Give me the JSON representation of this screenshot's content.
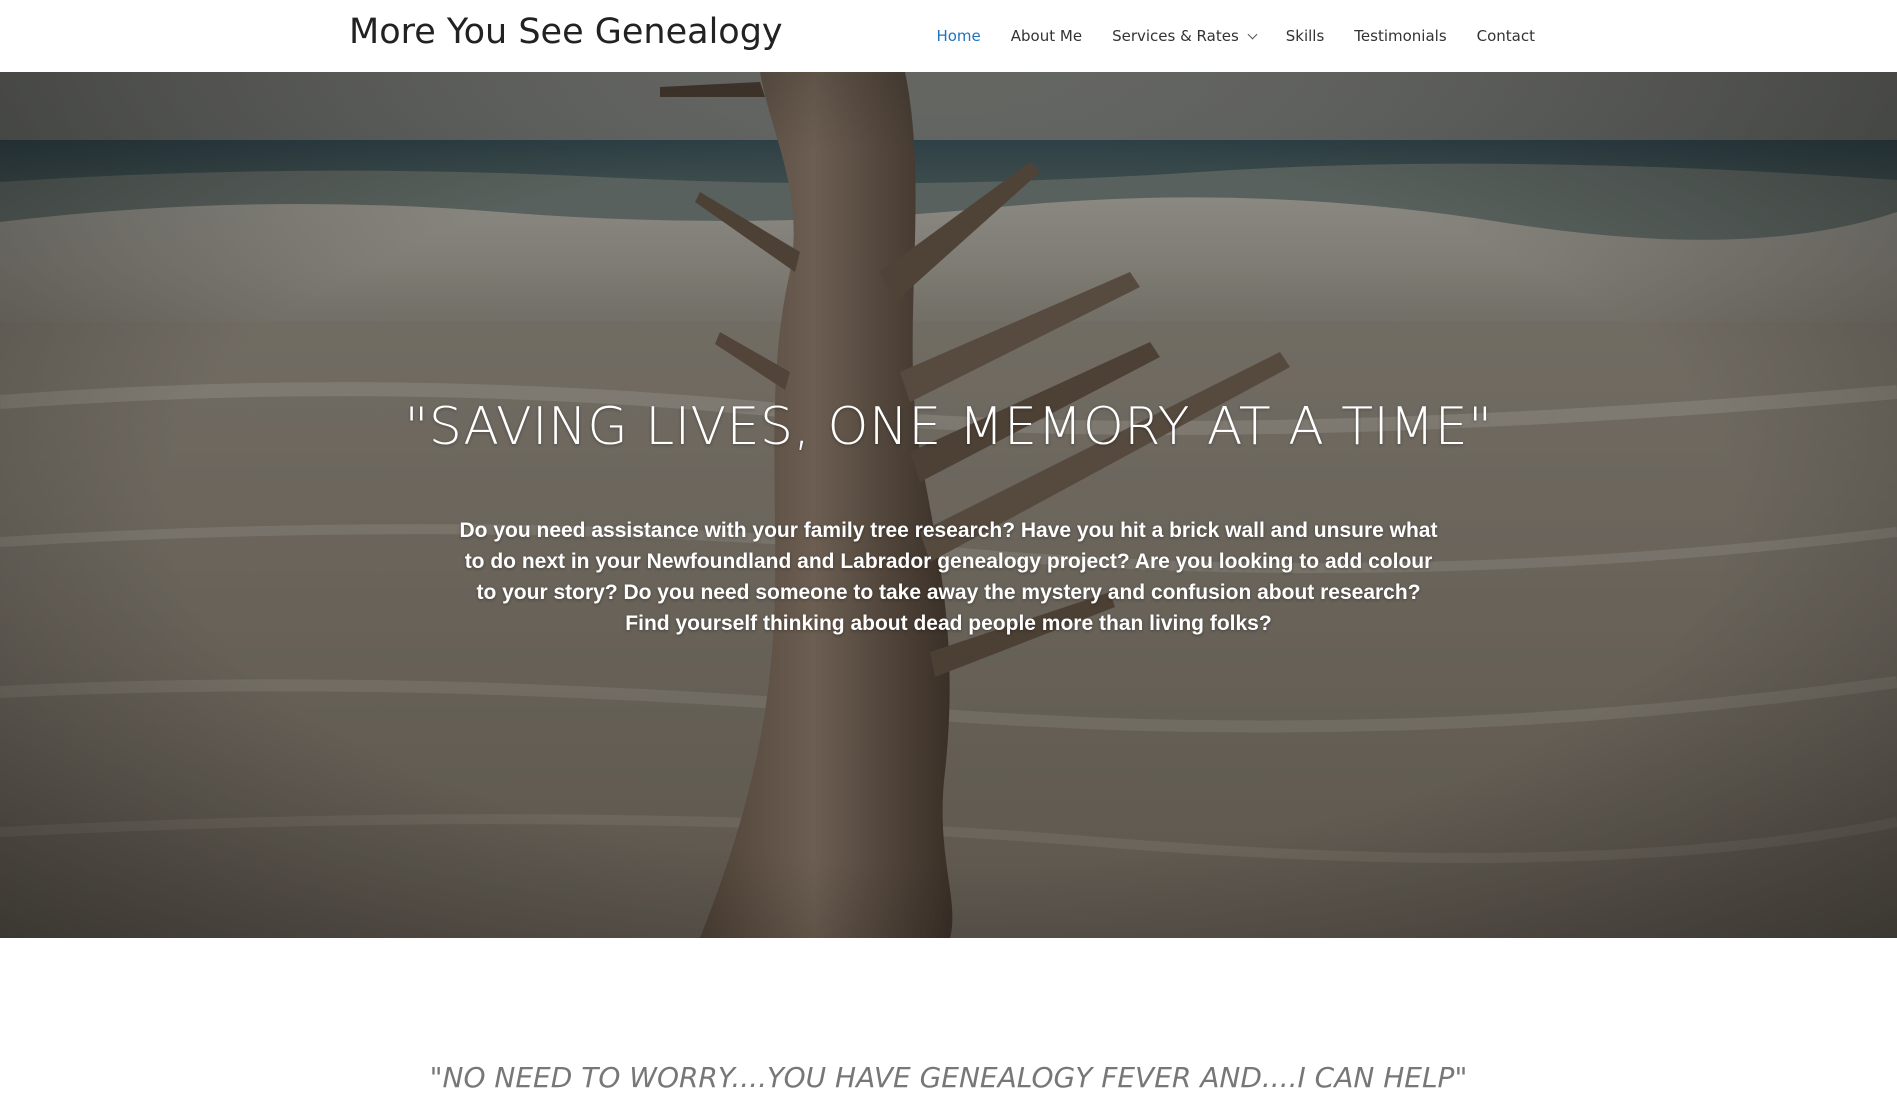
{
  "header": {
    "site_title": "More You See Genealogy",
    "nav": [
      {
        "label": "Home",
        "active": true
      },
      {
        "label": "About Me",
        "active": false
      },
      {
        "label": "Services & Rates",
        "active": false,
        "has_dropdown": true
      },
      {
        "label": "Skills",
        "active": false
      },
      {
        "label": "Testimonials",
        "active": false
      },
      {
        "label": "Contact",
        "active": false
      }
    ],
    "active_color": "#1e73be"
  },
  "hero": {
    "heading": "\"SAVING LIVES, ONE MEMORY AT A TIME\"",
    "body": "Do you need assistance with your family tree research? Have you hit a brick wall and unsure what to do next in your Newfoundland and Labrador genealogy project? Are you looking to add colour to your story? Do you need someone to take away the mystery and confusion about research? Find yourself thinking about dead people more than living folks?",
    "background_image": "driftwood-on-beach-photo"
  },
  "section": {
    "quote": "\"NO NEED TO WORRY....YOU HAVE GENEALOGY FEVER AND....I CAN HELP\""
  }
}
